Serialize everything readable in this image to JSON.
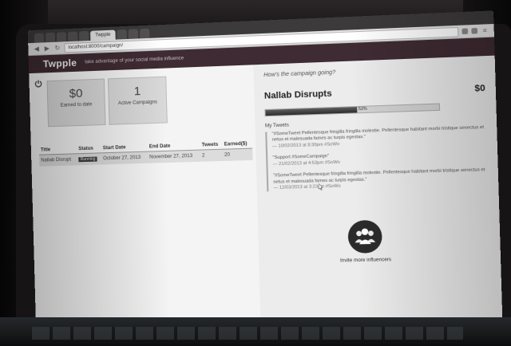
{
  "browser": {
    "tabs": [
      "Twpple",
      "",
      "",
      "",
      "",
      "",
      "",
      "",
      ""
    ],
    "active_tab_index": 0,
    "url": "localhost:8000/campaign/"
  },
  "app": {
    "brand": "Twpple",
    "tagline": "take advantage of your social media influence"
  },
  "stats": [
    {
      "value": "$0",
      "label": "Earned to date"
    },
    {
      "value": "1",
      "label": "Active Campaigns"
    }
  ],
  "campaign_table": {
    "headers": [
      "Title",
      "Status",
      "Start Date",
      "End Date",
      "Tweets",
      "Earned($)"
    ],
    "rows": [
      {
        "title": "Nallab Disrupt",
        "status": "Running",
        "start": "October 27, 2013",
        "end": "November 27, 2013",
        "tweets": "2",
        "earned": "20"
      }
    ]
  },
  "panel": {
    "question": "How's the campaign going?",
    "campaign_name": "Nallab Disrupts",
    "amount": "$0",
    "progress_percent": 53,
    "progress_label": "53%",
    "tweets_heading": "My Tweets",
    "tweets": [
      {
        "text": "\"#SomeTweet Pellentesque fringilla fringilla molestie. Pellentesque habitant morbi tristique senectus et netus et malesuada fames ac turpis egestas.\"",
        "meta": "— 10/02/2013 at 8:30pm #SoWo"
      },
      {
        "text": "\"Support #SomeCampaign\"",
        "meta": "— 21/02/2013 at 4:53pm #SoWo"
      },
      {
        "text": "\"#SomeTweet Pellentesque fringilla fringilla molestie. Pellentesque habitant morbi tristique senectus et netus et malesuada fames ac turpis egestas.\"",
        "meta": "— 12/03/2013 at 3:23pm #SoWo"
      }
    ],
    "invite_label": "Invite more influencers"
  },
  "colors": {
    "header": "#3f2b33",
    "progress_fill": "#3a3a3a"
  },
  "icons": [
    "power-icon",
    "people-group-icon",
    "mouse-cursor-icon"
  ]
}
